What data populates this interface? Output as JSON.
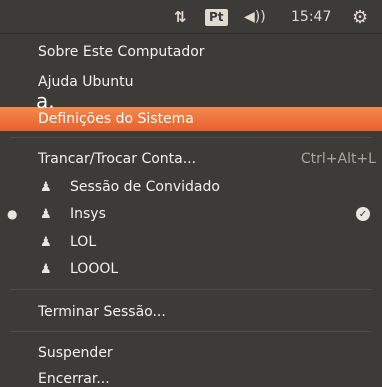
{
  "panel": {
    "network_icon": "up-down-arrows-icon",
    "keyboard_layout": "Pt",
    "volume_icon": "speaker-icon",
    "time": "15:47",
    "session_icon": "gear-power-icon"
  },
  "annotation": "a.",
  "menu": {
    "about": "Sobre Este Computador",
    "help": "Ajuda Ubuntu",
    "settings": "Definições do Sistema",
    "lock": "Trancar/Trocar Conta...",
    "lock_shortcut": "Ctrl+Alt+L",
    "users": [
      {
        "name": "Sessão de Convidado",
        "active": false,
        "logged_in": false
      },
      {
        "name": "Insys",
        "active": true,
        "logged_in": true
      },
      {
        "name": "LOL",
        "active": false,
        "logged_in": false
      },
      {
        "name": "LOOOL",
        "active": false,
        "logged_in": false
      }
    ],
    "logout": "Terminar Sessão...",
    "suspend": "Suspender",
    "shutdown": "Encerrar..."
  },
  "colors": {
    "panel_bg": "#3c3b37",
    "highlight": "#e8602e",
    "text": "#f2f1f0"
  }
}
